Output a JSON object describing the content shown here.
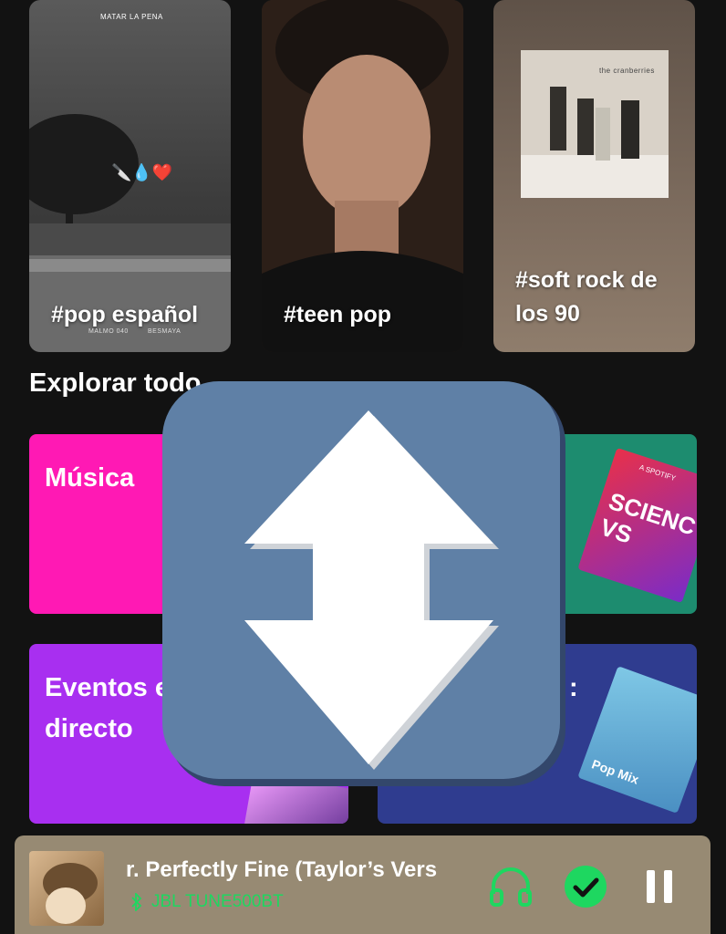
{
  "tags": [
    {
      "label": "#pop español",
      "cover_title": "MATAR LA PENA",
      "cover_artist": "MALMO 040",
      "cover_label": "BESMAYA"
    },
    {
      "label": "#teen pop"
    },
    {
      "label_line1": "#soft rock de",
      "label_line2": "los 90",
      "cover_title": "the cranberries"
    }
  ],
  "explore": {
    "title": "Explorar todo"
  },
  "categories": [
    {
      "label": "Música",
      "color": "#ff19b4"
    },
    {
      "label": "",
      "color": "#1d8c6f",
      "cover_text": "SCIENC VS",
      "cover_badge": "A SPOTIFY"
    },
    {
      "label_line1": "Eventos e",
      "label_line2": "directo",
      "color": "#a82ff0"
    },
    {
      "label": ":",
      "color": "#2f3c8f",
      "cover_text": "Pop Mix"
    }
  ],
  "player": {
    "track": "r. Perfectly Fine (Taylor’s Vers",
    "device": "JBL TUNE500BT",
    "accent": "#1ed760",
    "bg": "#978a73"
  },
  "icons": {
    "overlay": "up-down-arrows-icon",
    "headphones": "headphones-icon",
    "added": "check-circle-icon",
    "pause": "pause-icon",
    "bluetooth": "bluetooth-icon"
  }
}
